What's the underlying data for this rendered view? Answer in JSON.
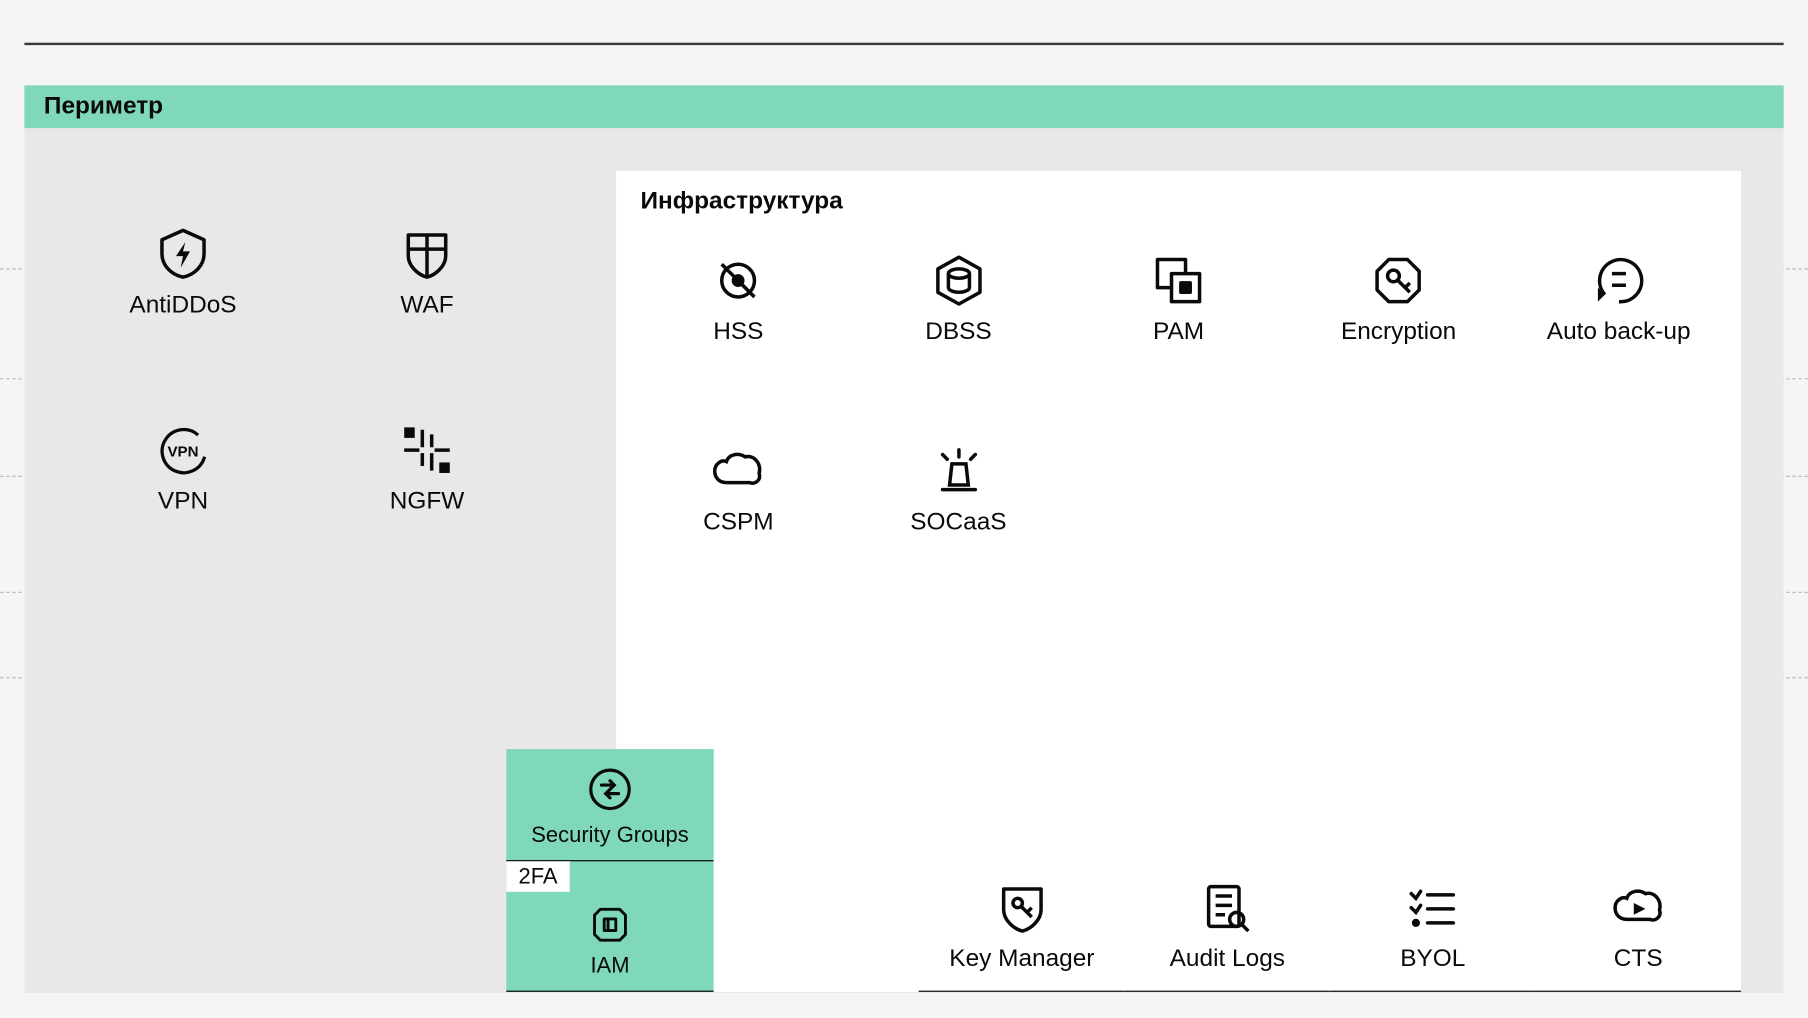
{
  "perimeter": {
    "title": "Периметр",
    "left_items": [
      {
        "label": "AntiDDoS",
        "icon": "shield-bolt-icon"
      },
      {
        "label": "WAF",
        "icon": "waf-shield-icon"
      },
      {
        "label": "VPN",
        "icon": "vpn-circle-icon"
      },
      {
        "label": "NGFW",
        "icon": "ngfw-icon"
      }
    ]
  },
  "infrastructure": {
    "title": "Инфраструктура",
    "row1": [
      {
        "label": "HSS",
        "icon": "hss-icon"
      },
      {
        "label": "DBSS",
        "icon": "dbss-icon"
      },
      {
        "label": "PAM",
        "icon": "pam-icon"
      },
      {
        "label": "Encryption",
        "icon": "encryption-icon"
      },
      {
        "label": "Auto back-up",
        "icon": "backup-icon"
      }
    ],
    "row2": [
      {
        "label": "CSPM",
        "icon": "cloud-icon"
      },
      {
        "label": "SOCaaS",
        "icon": "siren-icon"
      }
    ]
  },
  "bottom": {
    "sg": {
      "label": "Security Groups",
      "twofa": "2FA",
      "iam_label": "IAM"
    },
    "items": [
      {
        "label": "Key Manager",
        "icon": "key-shield-icon"
      },
      {
        "label": "Audit Logs",
        "icon": "audit-icon"
      },
      {
        "label": "BYOL",
        "icon": "checklist-icon"
      },
      {
        "label": "CTS",
        "icon": "cloud-play-icon"
      }
    ]
  }
}
